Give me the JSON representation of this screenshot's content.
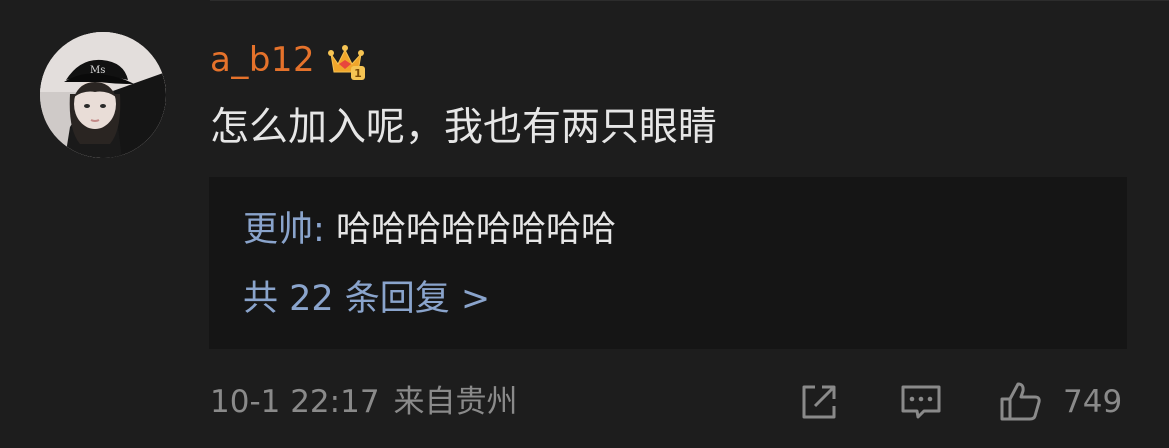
{
  "comment": {
    "username": "a_b12",
    "vip_level": "1",
    "text": "怎么加入呢，我也有两只眼睛",
    "reply_preview": {
      "author": "更帅",
      "separator": ": ",
      "content": "哈哈哈哈哈哈哈哈"
    },
    "reply_count_label": "共 22 条回复 >",
    "timestamp": "10-1 22:17",
    "source": "来自贵州",
    "like_count": "749"
  },
  "colors": {
    "background": "#1d1d1d",
    "reply_box": "#151515",
    "username": "#e5722b",
    "link": "#8aa4cc",
    "meta": "#8a8a8a",
    "text": "#e6e6e6"
  },
  "icons": {
    "avatar": "user-avatar-photo",
    "badge": "vip-crown-badge",
    "share": "share-icon",
    "comment": "comment-icon",
    "like": "thumbs-up-icon"
  }
}
